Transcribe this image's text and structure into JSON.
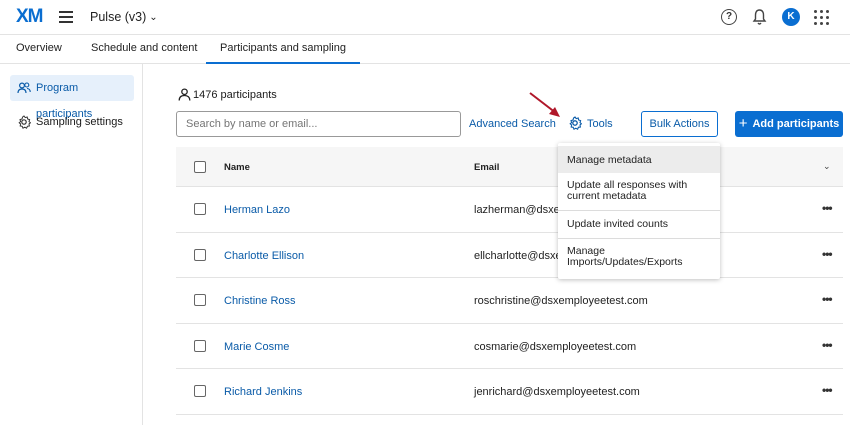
{
  "header": {
    "logo": "XM",
    "project_name": "Pulse (v3)",
    "help_symbol": "?",
    "avatar_initial": "K"
  },
  "tabs": [
    {
      "label": "Overview",
      "active": false
    },
    {
      "label": "Schedule and content",
      "active": false
    },
    {
      "label": "Participants and sampling",
      "active": true
    }
  ],
  "sidebar": {
    "items": [
      {
        "label": "Program participants",
        "icon": "participants-icon",
        "active": true
      },
      {
        "label": "Sampling settings",
        "icon": "gear-icon",
        "active": false
      }
    ]
  },
  "main": {
    "participant_count": "1476 participants",
    "search_placeholder": "Search by name or email...",
    "advanced_search": "Advanced Search",
    "tools_label": "Tools",
    "bulk_actions": "Bulk Actions",
    "add_participants": "Add participants",
    "add_symbol": "+"
  },
  "table": {
    "columns": [
      "Name",
      "Email"
    ],
    "row_menu_symbol": "•••",
    "rows": [
      {
        "name": "Herman Lazo",
        "email": "lazherman@dsxem"
      },
      {
        "name": "Charlotte Ellison",
        "email": "ellcharlotte@dsxem"
      },
      {
        "name": "Christine Ross",
        "email": "roschristine@dsxemployeetest.com"
      },
      {
        "name": "Marie Cosme",
        "email": "cosmarie@dsxemployeetest.com"
      },
      {
        "name": "Richard Jenkins",
        "email": "jenrichard@dsxemployeetest.com"
      }
    ]
  },
  "tools_menu": {
    "items": [
      {
        "label": "Manage metadata",
        "highlighted": true
      },
      {
        "label": "Update all responses with current metadata",
        "highlighted": false
      },
      {
        "label": "Update invited counts",
        "highlighted": false
      },
      {
        "label": "Manage Imports/Updates/Exports",
        "highlighted": false
      }
    ]
  },
  "colors": {
    "brand_blue": "#0a6ed1",
    "link_blue": "#0a5ba8",
    "arrow_red": "#b0172a",
    "active_sidebar_bg": "#e6f0fb"
  }
}
